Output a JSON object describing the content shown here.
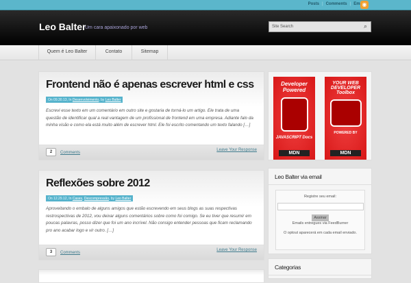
{
  "topbar": {
    "links": [
      "Posts",
      "Comments",
      "Email"
    ]
  },
  "header": {
    "title": "Leo Balter",
    "tagline": "Um cara apaixonado por web",
    "search_placeholder": "Site Search"
  },
  "nav": [
    "Quem é Leo Balter",
    "Contato",
    "Sitemap"
  ],
  "posts": [
    {
      "title": "Frontend não é apenas escrever html e css",
      "date_prefix": "On 09.30.13, In",
      "category": "Desenvolvimento",
      "by": ", by",
      "author": "Leo Balter",
      "excerpt": "Escrevi esse texto em um comentário em outro site e gostaria de torná-lo um artigo. Ele trata de uma questão de identificar qual a real vantagem de um profissional de frontend em uma empresa. Adiante falo da minha visão e como ela está muito além de escrever html. Ele foi escrito comentando um texto falando […]",
      "comments_count": "2",
      "comments_label": "Comments",
      "leave": "Leave Your Response"
    },
    {
      "title": "Reflexões sobre 2012",
      "date_prefix": "On 12.29.12, In",
      "category": "Cases",
      "category2": "Descompressão",
      "by": ", by",
      "author": "Leo Balter",
      "excerpt": "Aproveitando o embalo de alguns amigos que estão escrevendo em seus blogs as suas respectivas restrospectivas de 2012, vou deixar alguns comentários sobre como foi comigo. Se eu tiver que resumir em poucas palavras, posso dizer que foi um ano incrível. Não consigo entender pessoas que ficam reclamando pro ano acabar logo e vir outro. […]",
      "comments_count": "3",
      "comments_label": "Comments",
      "leave": "Leave Your Response"
    }
  ],
  "ads": [
    {
      "top": "Developer Powered",
      "bottom": "JAVASCRIPT Docs",
      "brand": "MDN"
    },
    {
      "top": "YOUR WEB DEVELOPER Toolbox",
      "bottom": "POWERED BY",
      "brand": "MDN"
    }
  ],
  "email_widget": {
    "title": "Leo Balter via email",
    "label": "Registre seu email:",
    "button": "Assinar",
    "delivered": "Emails entregues via FeedBurner",
    "optout": "O optout aparecerá em cada email enviado."
  },
  "categories_widget": {
    "title": "Categorias"
  }
}
